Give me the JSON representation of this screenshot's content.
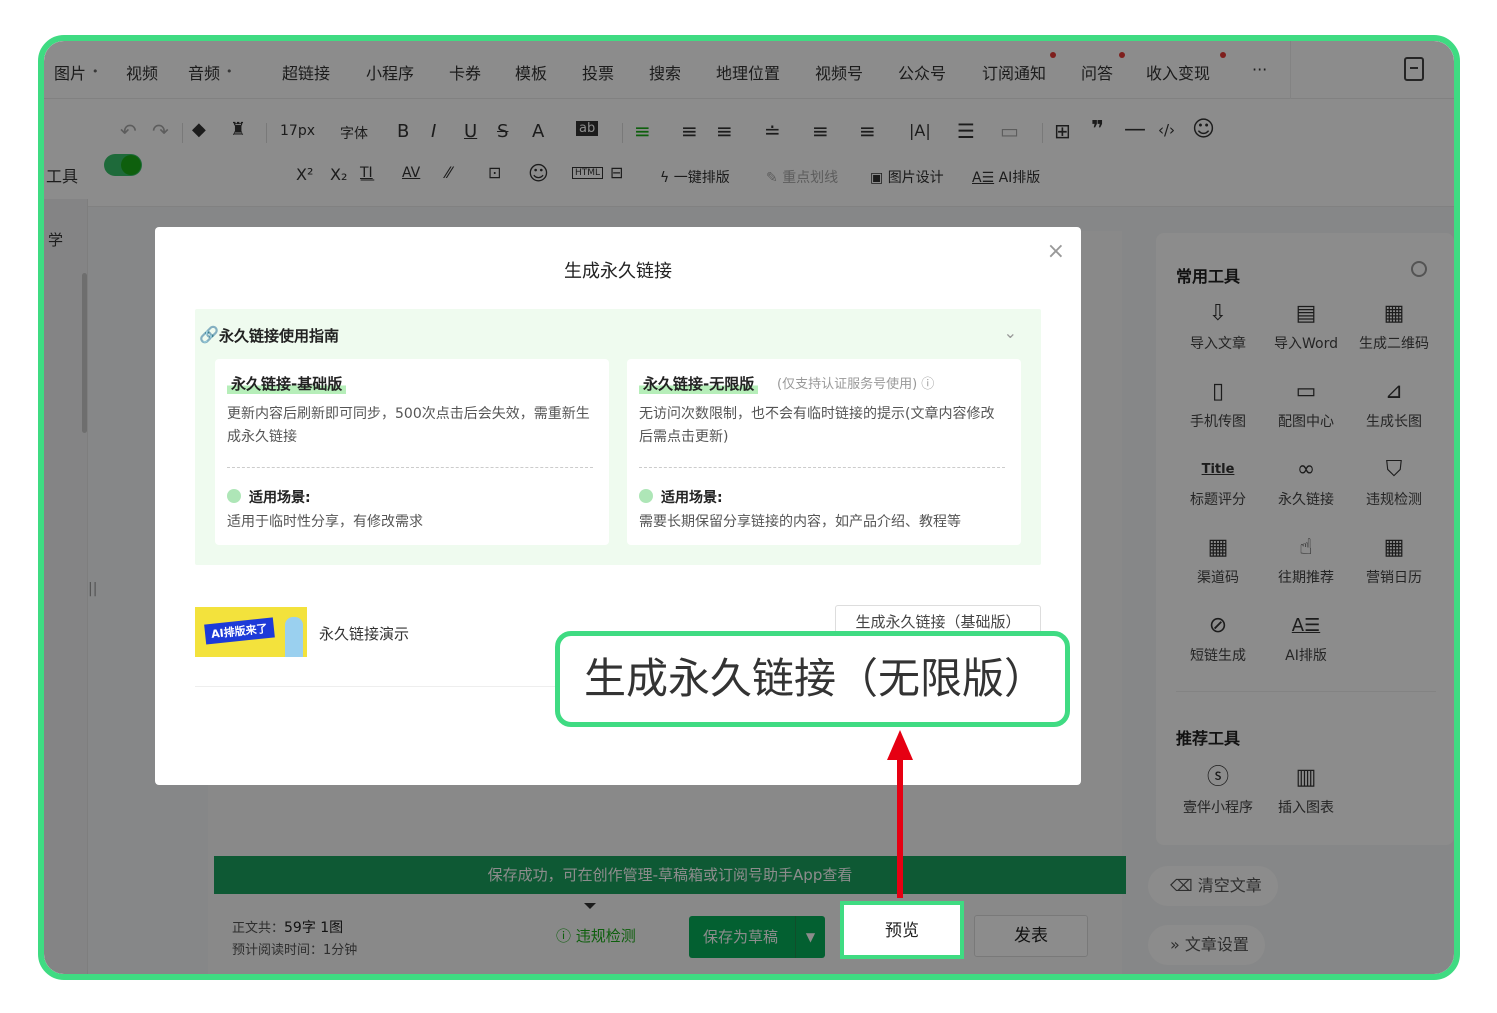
{
  "menubar": {
    "items": [
      "图片",
      "视频",
      "音频",
      "超链接",
      "小程序",
      "卡券",
      "模板",
      "投票",
      "搜索",
      "地理位置",
      "视频号",
      "公众号",
      "订阅通知",
      "问答",
      "收入变现"
    ],
    "more": "···"
  },
  "toolbar": {
    "font_size": "17px",
    "font_family": "字体",
    "one_click": "一键排版",
    "highlight": "重点划线",
    "image_design": "图片设计",
    "ai_layout": "AI排版",
    "left_tools_label": "工具",
    "left_side_label": "学"
  },
  "modal": {
    "title": "生成永久链接",
    "close": "×",
    "guide": {
      "title": "永久链接使用指南",
      "basic": {
        "title": "永久链接-基础版",
        "desc": "更新内容后刷新即可同步，500次点击后会失效，需重新生成永久链接",
        "scene_label": "适用场景:",
        "scene": "适用于临时性分享，有修改需求"
      },
      "unlimited": {
        "title": "永久链接-无限版",
        "note": "(仅支持认证服务号使用)",
        "desc": "无访问次数限制，也不会有临时链接的提示(文章内容修改后需点击更新)",
        "scene_label": "适用场景:",
        "scene": "需要长期保留分享链接的内容，如产品介绍、教程等"
      }
    },
    "article": {
      "thumb_text": "AI排版来了",
      "title": "永久链接演示",
      "basic_button": "生成永久链接（基础版）"
    }
  },
  "callout": {
    "text": "生成永久链接（无限版）"
  },
  "editor": {
    "save_banner": "保存成功，可在创作管理-草稿箱或订阅号助手App查看",
    "word_count_label": "正文共：",
    "word_count_value": "59字 1图",
    "read_time": "预计阅读时间：1分钟",
    "check_button": "违规检测",
    "draft_button": "保存为草稿",
    "preview_button": "预览",
    "publish_button": "发表"
  },
  "right_panel": {
    "common_title": "常用工具",
    "tools": [
      {
        "label": "导入文章",
        "icon": "import-icon"
      },
      {
        "label": "导入Word",
        "icon": "word-icon"
      },
      {
        "label": "生成二维码",
        "icon": "qrcode-icon"
      },
      {
        "label": "手机传图",
        "icon": "phone-upload-icon"
      },
      {
        "label": "配图中心",
        "icon": "image-icon"
      },
      {
        "label": "生成长图",
        "icon": "long-image-icon"
      },
      {
        "label": "标题评分",
        "icon": "title-icon"
      },
      {
        "label": "永久链接",
        "icon": "link-icon"
      },
      {
        "label": "违规检测",
        "icon": "shield-icon"
      },
      {
        "label": "渠道码",
        "icon": "channel-code-icon"
      },
      {
        "label": "往期推荐",
        "icon": "thumbs-up-icon"
      },
      {
        "label": "营销日历",
        "icon": "calendar-icon"
      },
      {
        "label": "短链生成",
        "icon": "short-link-icon"
      },
      {
        "label": "AI排版",
        "icon": "ai-layout-icon"
      }
    ],
    "recommend_title": "推荐工具",
    "recommend": [
      {
        "label": "壹伴小程序",
        "icon": "mini-program-icon"
      },
      {
        "label": "插入图表",
        "icon": "chart-icon"
      }
    ],
    "clear_article": "清空文章",
    "article_settings": "文章设置"
  },
  "colors": {
    "highlight_frame": "#3fdb82",
    "arrow": "#e60012",
    "brand_green": "#07b05a"
  }
}
